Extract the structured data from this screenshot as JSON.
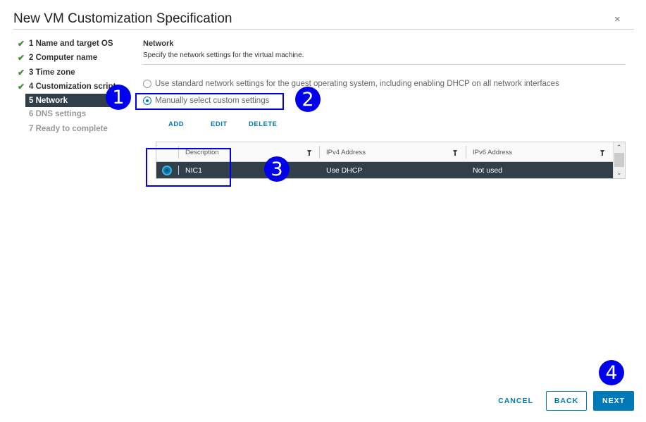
{
  "dialog": {
    "title": "New VM Customization Specification",
    "close_glyph": "×"
  },
  "steps": [
    {
      "label": "1 Name and target OS",
      "state": "complete"
    },
    {
      "label": "2 Computer name",
      "state": "complete"
    },
    {
      "label": "3 Time zone",
      "state": "complete"
    },
    {
      "label": "4 Customization script",
      "state": "complete"
    },
    {
      "label": "5 Network",
      "state": "active"
    },
    {
      "label": "6 DNS settings",
      "state": "pending"
    },
    {
      "label": "7 Ready to complete",
      "state": "pending"
    }
  ],
  "network": {
    "title": "Network",
    "description": "Specify the network settings for the virtual machine.",
    "option_standard": "Use standard network settings for the guest operating system, including enabling DHCP on all network interfaces",
    "option_manual": "Manually select custom settings",
    "selected_option": "manual"
  },
  "actions": {
    "add": "ADD",
    "edit": "EDIT",
    "delete": "DELETE"
  },
  "grid": {
    "columns": [
      "Description",
      "IPv4 Address",
      "IPv6 Address"
    ],
    "rows": [
      {
        "description": "NIC1",
        "ipv4": "Use DHCP",
        "ipv6": "Not used",
        "selected": true
      }
    ]
  },
  "markers": [
    "1",
    "2",
    "3",
    "4"
  ],
  "footer": {
    "cancel": "CANCEL",
    "back": "BACK",
    "next": "NEXT"
  },
  "colors": {
    "accent": "#0079b8",
    "active_step_bg": "#313f4a",
    "check_green": "#3c8a2e",
    "annotation_blue": "#0000ee"
  }
}
